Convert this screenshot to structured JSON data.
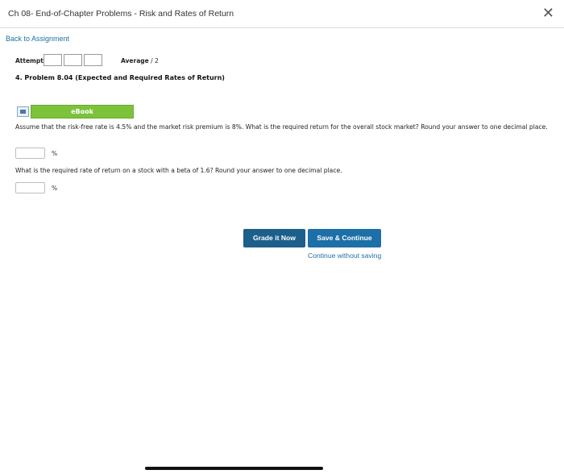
{
  "window": {
    "title": "Ch 08- End-of-Chapter Problems - Risk and Rates of Return"
  },
  "nav": {
    "back_link": "Back to Assignment"
  },
  "attempts": {
    "label": "Attempts"
  },
  "average": {
    "label": "Average",
    "value": "/ 2"
  },
  "problem": {
    "title": "4. Problem 8.04 (Expected and Required Rates of Return)",
    "ebook_label": "eBook",
    "q1_text": "Assume that the risk-free rate is 4.5% and the market risk premium is 8%. What is the required return for the overall stock market? Round your answer to one decimal place.",
    "q1_unit": "%",
    "q1_value": "",
    "q2_text": "What is the required rate of return on a stock with a beta of 1.6? Round your answer to one decimal place.",
    "q2_unit": "%",
    "q2_value": ""
  },
  "actions": {
    "grade_label": "Grade it Now",
    "save_label": "Save & Continue",
    "continue_label": "Continue without saving"
  },
  "icons": {
    "close": "close-icon",
    "ebook": "book-icon"
  },
  "colors": {
    "link": "#1f6fa8",
    "ebook_bar": "#7cc23a",
    "grade_button": "#1c5f8b",
    "save_button": "#1c6fa7"
  }
}
